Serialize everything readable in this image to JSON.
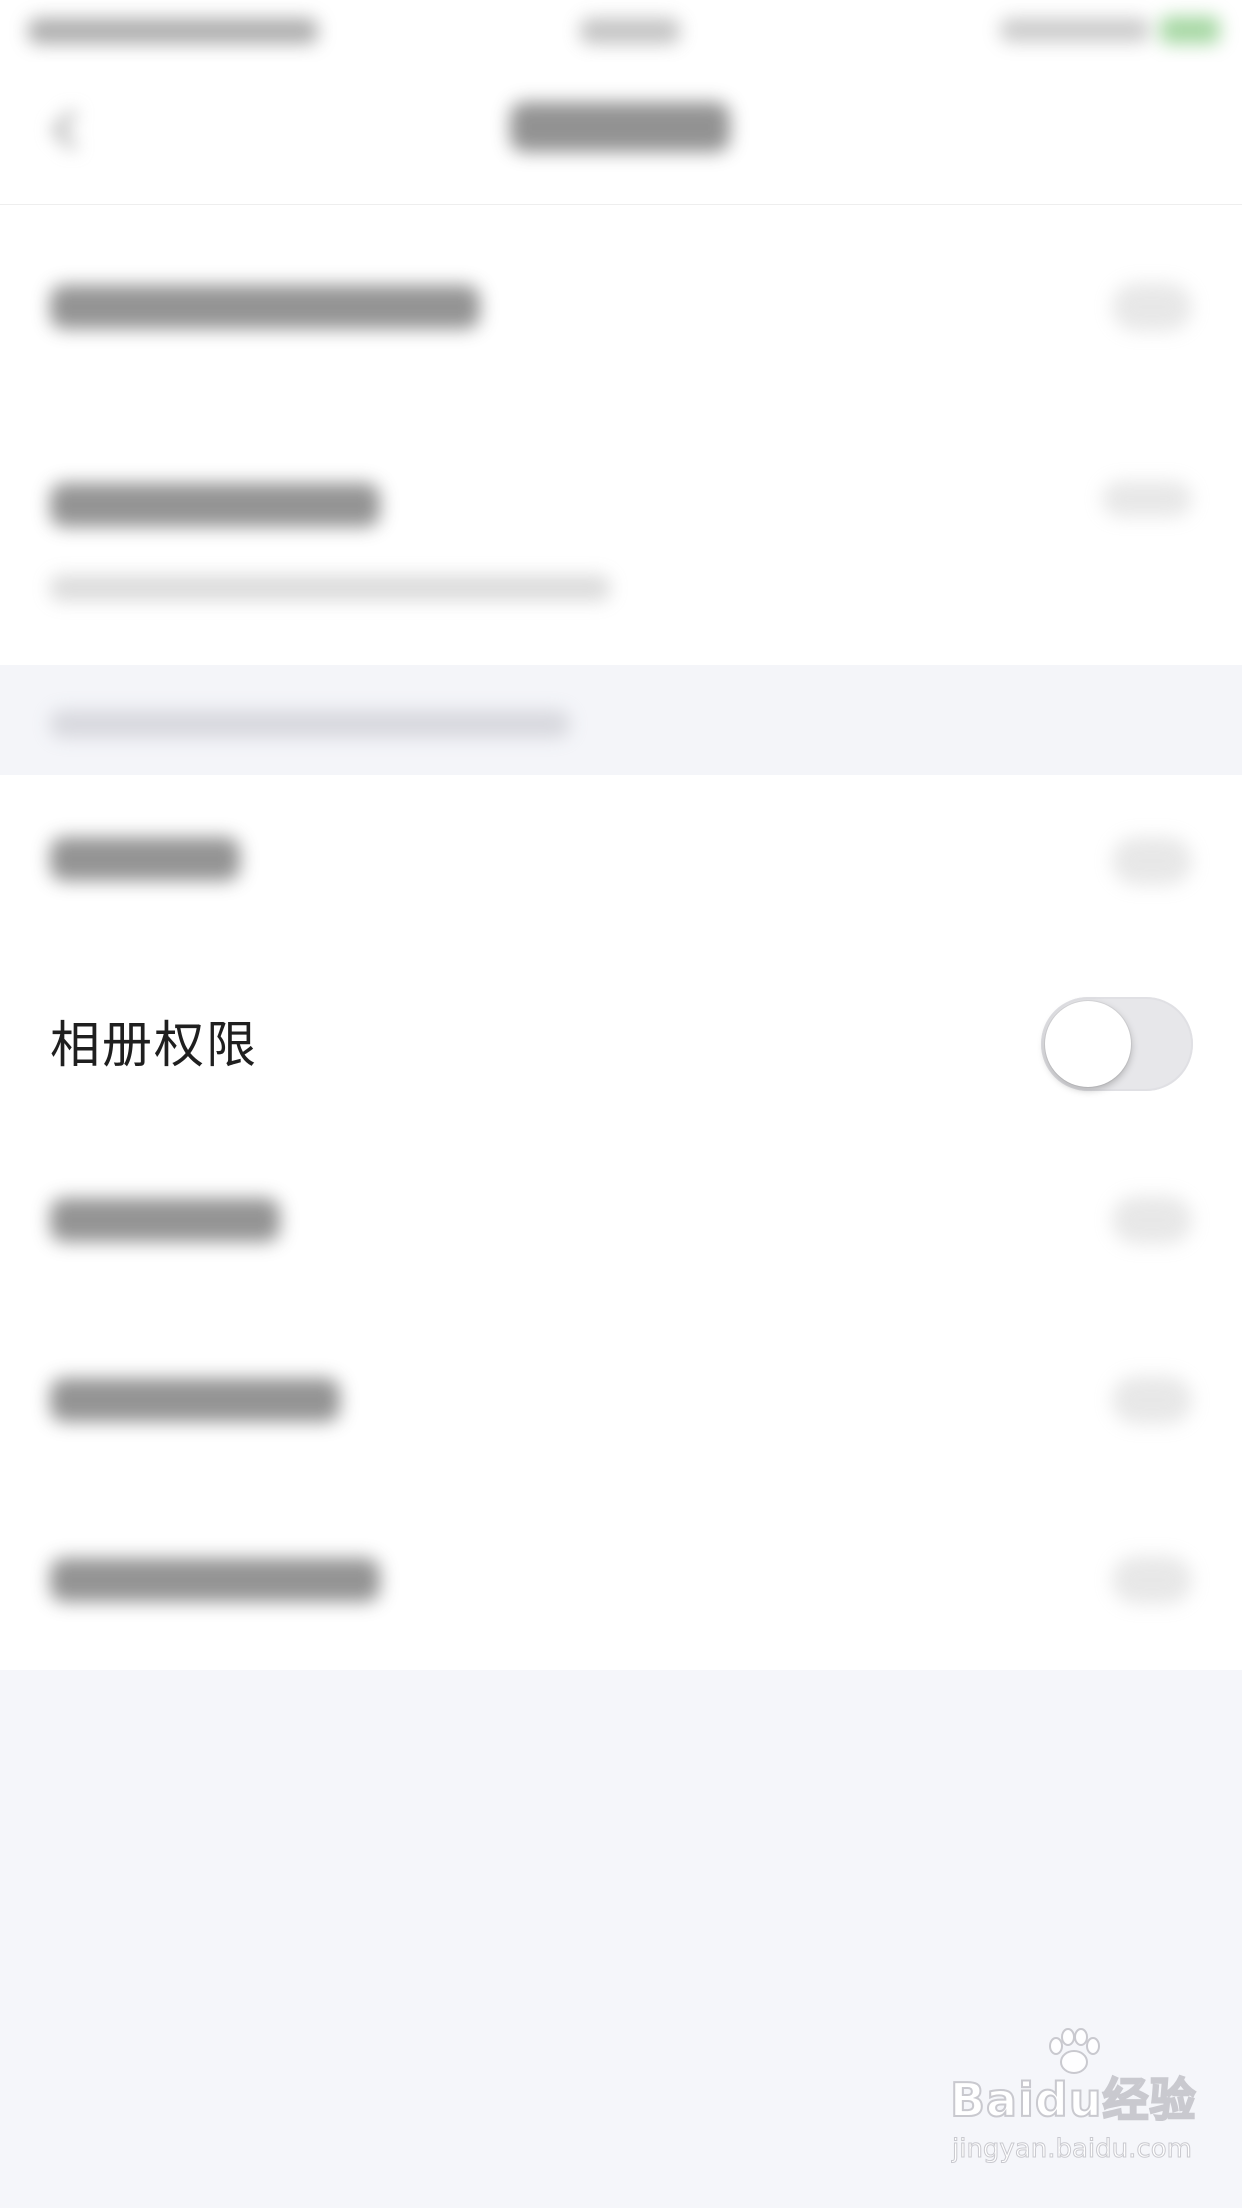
{
  "settings": {
    "focused_row": {
      "label": "相册权限",
      "toggle_on": false
    }
  },
  "colors": {
    "background": "#f5f6fa",
    "row_background": "#ffffff",
    "toggle_off": "#e7e7ea",
    "text": "#1f1f1f"
  },
  "watermark": {
    "logo": "Baidu经验",
    "url": "jingyan.baidu.com"
  }
}
